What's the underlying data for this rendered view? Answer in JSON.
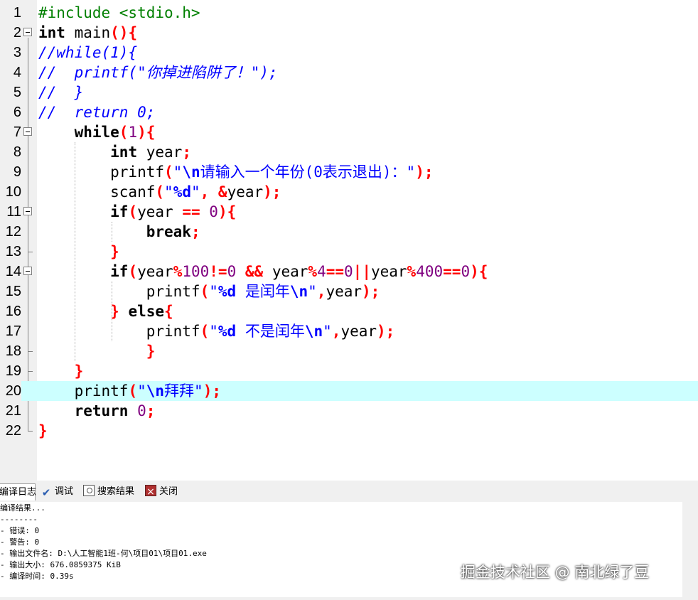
{
  "editor": {
    "current_line": 20,
    "lines": [
      [
        [
          "pp",
          "#include <stdio.h>"
        ]
      ],
      [
        [
          "kw",
          "int"
        ],
        [
          "id",
          " main"
        ],
        [
          "sym",
          "(){"
        ]
      ],
      [
        [
          "cm",
          "//while(1){"
        ]
      ],
      [
        [
          "cm",
          "//  printf(\"你掉进陷阱了！\");"
        ]
      ],
      [
        [
          "cm",
          "//  }"
        ]
      ],
      [
        [
          "cm",
          "//  return 0;"
        ]
      ],
      [
        [
          "id",
          "    "
        ],
        [
          "kw",
          "while"
        ],
        [
          "sym",
          "("
        ],
        [
          "num",
          "1"
        ],
        [
          "sym",
          "){"
        ]
      ],
      [
        [
          "id",
          "        "
        ],
        [
          "kw",
          "int"
        ],
        [
          "id",
          " year"
        ],
        [
          "sym",
          ";"
        ]
      ],
      [
        [
          "id",
          "        printf"
        ],
        [
          "sym",
          "("
        ],
        [
          "str",
          "\""
        ],
        [
          "esc",
          "\\n"
        ],
        [
          "str",
          "请输入一个年份(0表示退出)：\""
        ],
        [
          "sym",
          ");"
        ]
      ],
      [
        [
          "id",
          "        scanf"
        ],
        [
          "sym",
          "("
        ],
        [
          "str",
          "\""
        ],
        [
          "esc",
          "%d"
        ],
        [
          "str",
          "\""
        ],
        [
          "sym",
          ", &"
        ],
        [
          "id",
          "year"
        ],
        [
          "sym",
          ");"
        ]
      ],
      [
        [
          "id",
          "        "
        ],
        [
          "kw",
          "if"
        ],
        [
          "sym",
          "("
        ],
        [
          "id",
          "year "
        ],
        [
          "sym",
          "=="
        ],
        [
          "id",
          " "
        ],
        [
          "num",
          "0"
        ],
        [
          "sym",
          "){"
        ]
      ],
      [
        [
          "id",
          "            "
        ],
        [
          "kw",
          "break"
        ],
        [
          "sym",
          ";"
        ]
      ],
      [
        [
          "id",
          "        "
        ],
        [
          "sym",
          "}"
        ]
      ],
      [
        [
          "id",
          "        "
        ],
        [
          "kw",
          "if"
        ],
        [
          "sym",
          "("
        ],
        [
          "id",
          "year"
        ],
        [
          "sym",
          "%"
        ],
        [
          "num",
          "100"
        ],
        [
          "sym",
          "!="
        ],
        [
          "num",
          "0"
        ],
        [
          "id",
          " "
        ],
        [
          "sym",
          "&&"
        ],
        [
          "id",
          " year"
        ],
        [
          "sym",
          "%"
        ],
        [
          "num",
          "4"
        ],
        [
          "sym",
          "=="
        ],
        [
          "num",
          "0"
        ],
        [
          "sym",
          "||"
        ],
        [
          "id",
          "year"
        ],
        [
          "sym",
          "%"
        ],
        [
          "num",
          "400"
        ],
        [
          "sym",
          "=="
        ],
        [
          "num",
          "0"
        ],
        [
          "sym",
          "){"
        ]
      ],
      [
        [
          "id",
          "            printf"
        ],
        [
          "sym",
          "("
        ],
        [
          "str",
          "\""
        ],
        [
          "esc",
          "%d"
        ],
        [
          "str",
          " 是闰年"
        ],
        [
          "esc",
          "\\n"
        ],
        [
          "str",
          "\""
        ],
        [
          "sym",
          ","
        ],
        [
          "id",
          "year"
        ],
        [
          "sym",
          ");"
        ]
      ],
      [
        [
          "id",
          "        "
        ],
        [
          "sym",
          "}"
        ],
        [
          "id",
          " "
        ],
        [
          "kw",
          "else"
        ],
        [
          "sym",
          "{"
        ]
      ],
      [
        [
          "id",
          "            printf"
        ],
        [
          "sym",
          "("
        ],
        [
          "str",
          "\""
        ],
        [
          "esc",
          "%d"
        ],
        [
          "str",
          " 不是闰年"
        ],
        [
          "esc",
          "\\n"
        ],
        [
          "str",
          "\""
        ],
        [
          "sym",
          ","
        ],
        [
          "id",
          "year"
        ],
        [
          "sym",
          ");"
        ]
      ],
      [
        [
          "id",
          "            "
        ],
        [
          "sym",
          "}"
        ]
      ],
      [
        [
          "id",
          "    "
        ],
        [
          "sym",
          "}"
        ]
      ],
      [
        [
          "id",
          "    printf"
        ],
        [
          "sym",
          "("
        ],
        [
          "str",
          "\""
        ],
        [
          "esc",
          "\\n"
        ],
        [
          "str",
          "拜拜\""
        ],
        [
          "sym",
          ");"
        ]
      ],
      [
        [
          "id",
          "    "
        ],
        [
          "kw",
          "return"
        ],
        [
          "id",
          " "
        ],
        [
          "num",
          "0"
        ],
        [
          "sym",
          ";"
        ]
      ],
      [
        [
          "sym",
          "}"
        ]
      ]
    ],
    "fold_markers": [
      2,
      7,
      11,
      14
    ]
  },
  "panel": {
    "tabs": [
      {
        "label": "编译日志",
        "icon": "compile-log-icon"
      },
      {
        "label": "调试",
        "icon": "check-icon"
      },
      {
        "label": "搜索结果",
        "icon": "search-results-icon"
      },
      {
        "label": "关闭",
        "icon": "close-icon"
      }
    ],
    "log_lines": [
      "编译结果...",
      "--------",
      "- 错误: 0",
      "- 警告: 0",
      "- 输出文件名: D:\\人工智能1班-何\\项目01\\项目01.exe",
      "- 输出大小: 676.0859375 KiB",
      "- 编译时间: 0.39s"
    ]
  },
  "watermark": "掘金技术社区 @ 南北绿了豆"
}
